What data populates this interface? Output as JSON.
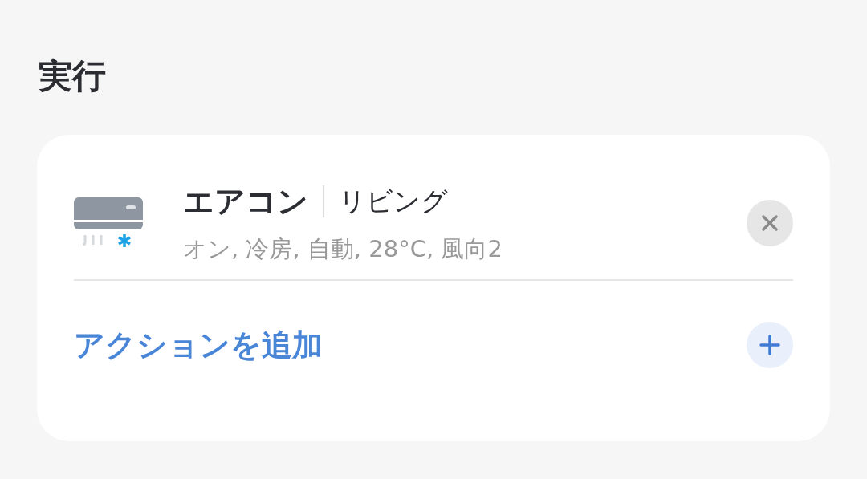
{
  "section_title": "実行",
  "actions": [
    {
      "device": "エアコン",
      "room": "リビング",
      "summary": "オン, 冷房, 自動, 28°C, 風向2"
    }
  ],
  "add_action": {
    "label": "アクションを追加"
  }
}
